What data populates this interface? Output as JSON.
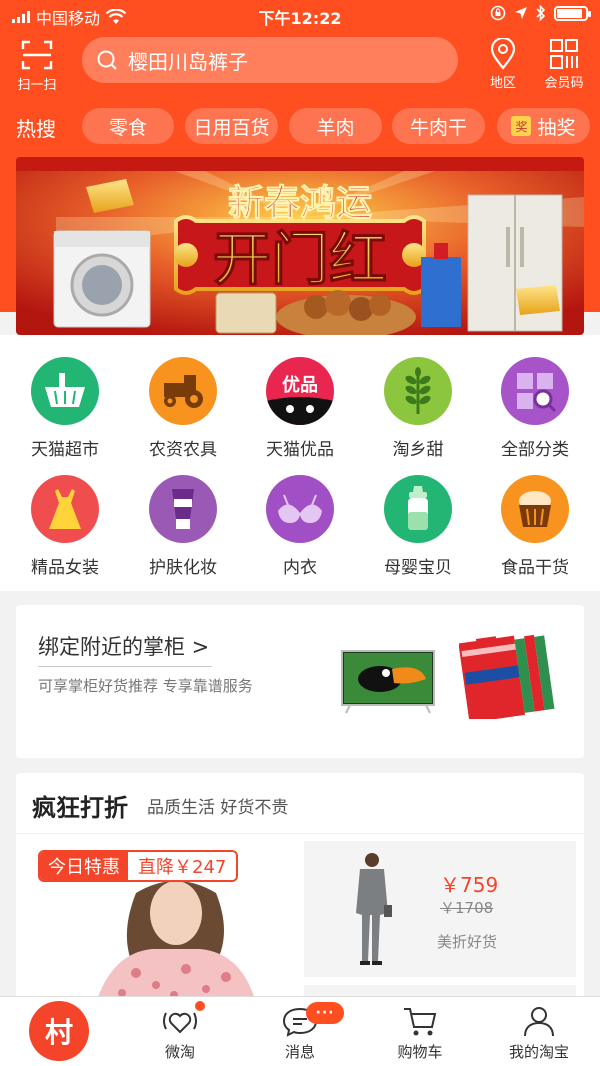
{
  "status_bar": {
    "carrier": "中国移动",
    "time": "下午12:22",
    "battery_level": 0.9
  },
  "header": {
    "scan_label": "扫一扫",
    "search_text": "樱田川岛裤子",
    "region_label": "地区",
    "member_label": "会员码"
  },
  "hot_search": {
    "label": "热搜",
    "chips": [
      "零食",
      "日用百货",
      "羊肉",
      "牛肉干",
      "抽奖"
    ],
    "lottery_icon_char": "奖"
  },
  "banner": {
    "line1": "新春鸿运",
    "line2": "开门红"
  },
  "categories": [
    {
      "label": "天猫超市",
      "icon": "basket-icon",
      "color": "#22b573"
    },
    {
      "label": "农资农具",
      "icon": "tractor-icon",
      "color": "#f7931e"
    },
    {
      "label": "天猫优品",
      "icon": "tmall-icon",
      "color": "#e8264f",
      "icon_text": "优品"
    },
    {
      "label": "淘乡甜",
      "icon": "wheat-icon",
      "color": "#8cc63f"
    },
    {
      "label": "全部分类",
      "icon": "grid-search-icon",
      "color": "#a654c8"
    },
    {
      "label": "精品女装",
      "icon": "dress-icon",
      "color": "#f04e4e"
    },
    {
      "label": "护肤化妆",
      "icon": "cosmetic-icon",
      "color": "#9b59b6"
    },
    {
      "label": "内衣",
      "icon": "bra-icon",
      "color": "#a04fc4"
    },
    {
      "label": "母婴宝贝",
      "icon": "baby-bottle-icon",
      "color": "#22b573"
    },
    {
      "label": "食品干货",
      "icon": "cake-icon",
      "color": "#f7931e"
    }
  ],
  "bind_card": {
    "title": "绑定附近的掌柜 >",
    "subtitle": "可享掌柜好货推荐  专享靠谱服务"
  },
  "deals": {
    "title": "疯狂打折",
    "subtitle": "品质生活 好货不贵",
    "today_label": "今日特惠",
    "drop_label": "直降￥247",
    "product": {
      "price": "￥759",
      "original_price": "￥1708",
      "tag": "美折好货"
    }
  },
  "tabbar": {
    "home_char": "村",
    "tabs": [
      "微淘",
      "消息",
      "购物车",
      "我的淘宝"
    ],
    "message_badge": "···"
  },
  "colors": {
    "brand": "#ff4e1f",
    "accent_red": "#f4452a"
  }
}
